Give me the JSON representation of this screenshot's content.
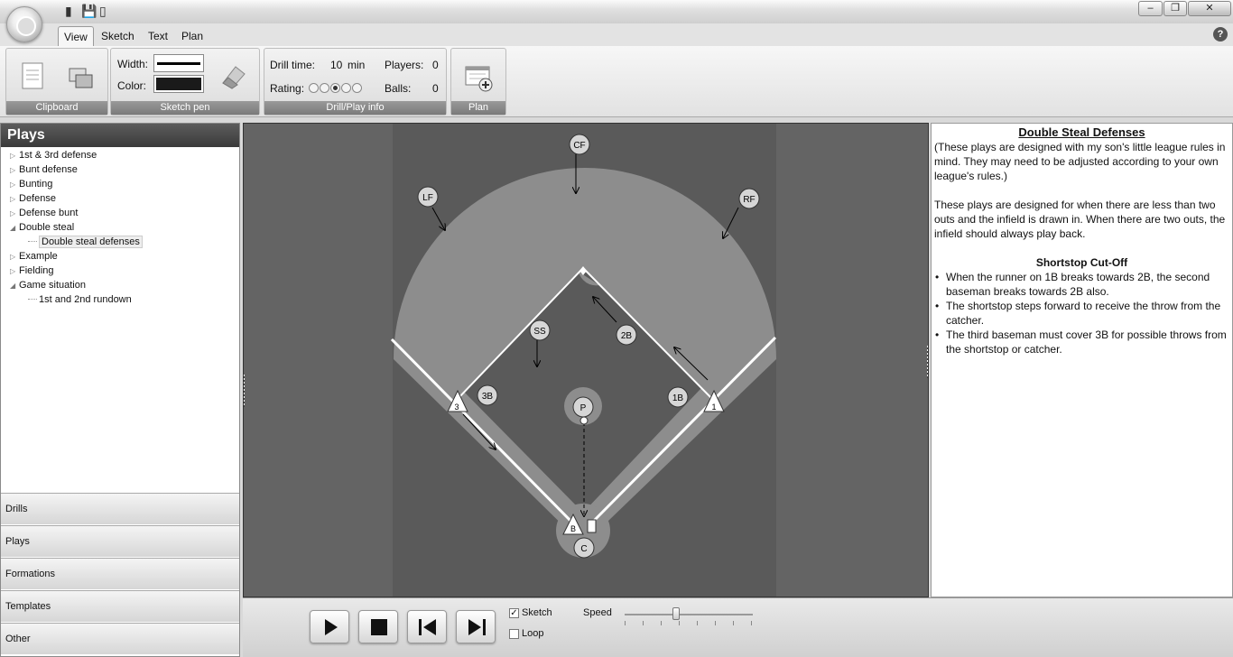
{
  "ribbon_tabs": [
    "View",
    "Sketch",
    "Text",
    "Plan"
  ],
  "clipboard": {
    "caption": "Clipboard"
  },
  "sketch_pen": {
    "caption": "Sketch pen",
    "width_label": "Width:",
    "color_label": "Color:"
  },
  "drill_info": {
    "caption": "Drill/Play info",
    "drill_time_label": "Drill time:",
    "drill_time_value": "10",
    "drill_time_unit": "min",
    "players_label": "Players:",
    "players_value": "0",
    "rating_label": "Rating:",
    "balls_label": "Balls:",
    "balls_value": "0",
    "rating_selected": 3
  },
  "plan": {
    "caption": "Plan"
  },
  "sidebar": {
    "title": "Plays",
    "tree": [
      {
        "label": "1st & 3rd defense",
        "level": 0,
        "state": "collapsed"
      },
      {
        "label": "Bunt defense",
        "level": 0,
        "state": "collapsed"
      },
      {
        "label": "Bunting",
        "level": 0,
        "state": "collapsed"
      },
      {
        "label": "Defense",
        "level": 0,
        "state": "collapsed"
      },
      {
        "label": "Defense bunt",
        "level": 0,
        "state": "collapsed"
      },
      {
        "label": "Double steal",
        "level": 0,
        "state": "expanded"
      },
      {
        "label": "Double steal defenses",
        "level": 1,
        "state": "selected"
      },
      {
        "label": "Example",
        "level": 0,
        "state": "collapsed"
      },
      {
        "label": "Fielding",
        "level": 0,
        "state": "collapsed"
      },
      {
        "label": "Game situation",
        "level": 0,
        "state": "expanded"
      },
      {
        "label": "1st and 2nd rundown",
        "level": 1,
        "state": "leaf"
      }
    ],
    "nav": [
      "Drills",
      "Plays",
      "Formations",
      "Templates",
      "Other"
    ]
  },
  "field": {
    "players": {
      "CF": "CF",
      "LF": "LF",
      "RF": "RF",
      "SS": "SS",
      "2B": "2B",
      "3B": "3B",
      "1B": "1B",
      "P": "P",
      "C": "C"
    },
    "bases": {
      "third": "3",
      "first": "1",
      "home": "B"
    }
  },
  "description": {
    "title": "Double Steal Defenses",
    "para1": "(These plays are designed with my son's little league rules in mind.  They may need to be adjusted according to your own league's rules.)",
    "para2": "These plays are designed for when there are less than two outs and the infield is drawn in.  When there are two outs, the infield should always play back.",
    "subtitle": "Shortstop Cut-Off",
    "bullets": [
      "When the runner on 1B breaks towards 2B, the second baseman breaks towards 2B also.",
      "The shortstop steps forward to receive the throw from the catcher.",
      "The third baseman must cover 3B for possible throws from the shortstop or catcher."
    ]
  },
  "controls": {
    "sketch_label": "Sketch",
    "sketch_checked": "✓",
    "loop_label": "Loop",
    "speed_label": "Speed",
    "speed_level": 0.4
  }
}
